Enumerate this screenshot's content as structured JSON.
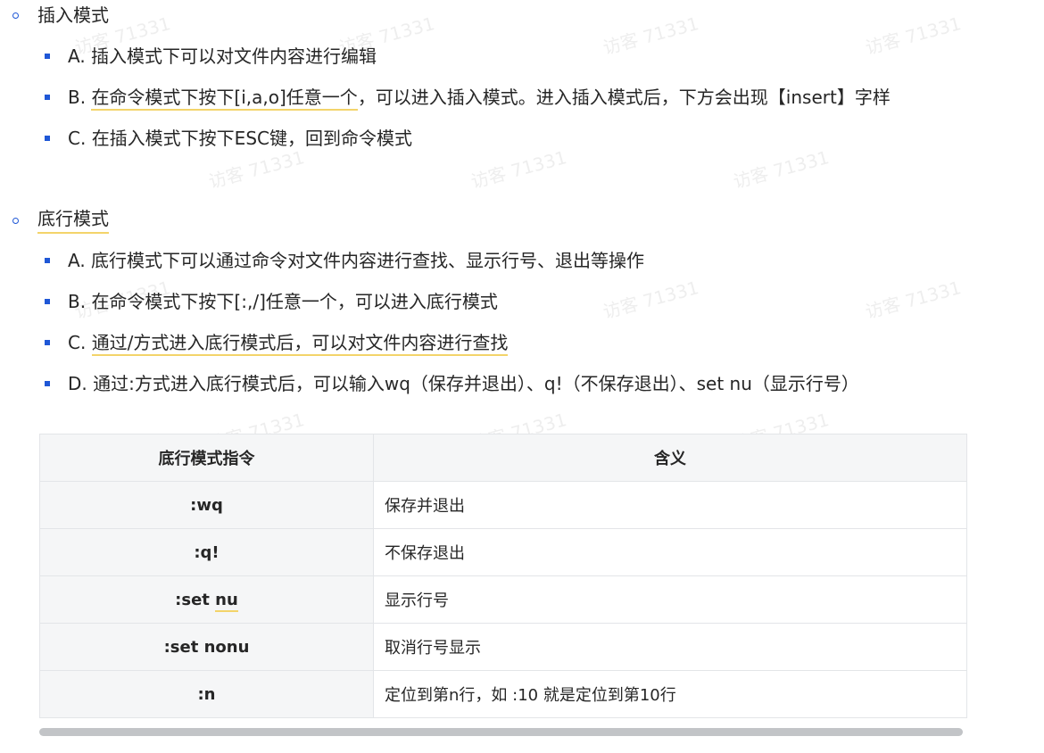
{
  "insert_mode": {
    "title": "插入模式",
    "items": [
      {
        "prefix": "A.",
        "text": "插入模式下可以对文件内容进行编辑"
      },
      {
        "prefix": "B.",
        "underlined": "在命令模式下按下[i,a,o]任意一个",
        "rest": "，可以进入插入模式。进入插入模式后，下方会出现【insert】字样"
      },
      {
        "prefix": "C.",
        "text": "在插入模式下按下ESC键，回到命令模式"
      }
    ]
  },
  "bottom_mode": {
    "title": "底行模式",
    "items": [
      {
        "prefix": "A.",
        "text": "底行模式下可以通过命令对文件内容进行查找、显示行号、退出等操作"
      },
      {
        "prefix": "B.",
        "text": "在命令模式下按下[:,/]任意一个，可以进入底行模式"
      },
      {
        "prefix": "C.",
        "underlined": "通过/方式进入底行模式后，可以对文件内容进行查找"
      },
      {
        "prefix": "D.",
        "text": "通过:方式进入底行模式后，可以输入wq（保存并退出）、q!（不保存退出）、set nu（显示行号）"
      }
    ]
  },
  "table": {
    "headers": [
      "底行模式指令",
      "含义"
    ],
    "rows": [
      {
        "cmd": ":wq",
        "meaning": "保存并退出"
      },
      {
        "cmd": ":q!",
        "meaning": "不保存退出"
      },
      {
        "cmd_prefix": ":set ",
        "cmd_underlined": "nu",
        "meaning": "显示行号"
      },
      {
        "cmd": ":set nonu",
        "meaning": "取消行号显示"
      },
      {
        "cmd": ":n",
        "meaning": "定位到第n行，如 :10 就是定位到第10行"
      }
    ]
  },
  "watermark": "访客 71331",
  "colors": {
    "bullet": "#1f57d6",
    "underline": "#f3d46a",
    "header_bg": "#f5f6f7"
  }
}
